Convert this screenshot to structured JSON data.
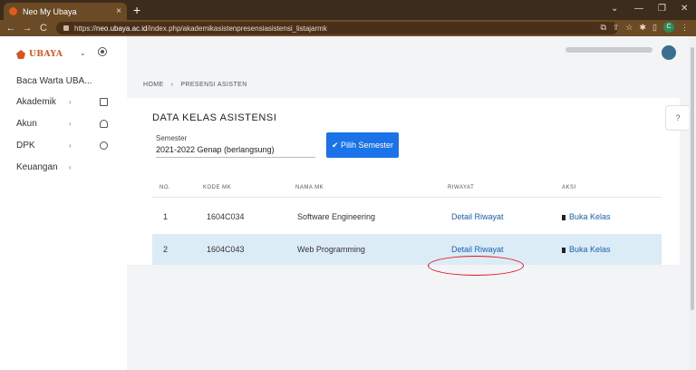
{
  "browser": {
    "tab_title": "Neo My Ubaya",
    "tab_close": "×",
    "new_tab": "+",
    "url_scheme": "https://",
    "url_host": "neo.ubaya.ac.id",
    "url_path": "/index.php/akademikasistenpresensiasistensi_listajarmk",
    "profile_initial": "C",
    "window_controls": [
      "⌄",
      "—",
      "❐",
      "✕"
    ],
    "nav": [
      "←",
      "→",
      "C"
    ],
    "toolbar_icons": [
      "⧉",
      "⇪",
      "☆",
      "✱",
      "▯",
      "⋮"
    ]
  },
  "sidebar": {
    "logo_text": "UBAYA",
    "items": [
      {
        "label": "Baca Warta UBA...",
        "arrow": "",
        "icon": ""
      },
      {
        "label": "Akademik",
        "arrow": "‹",
        "icon": "book-icon"
      },
      {
        "label": "Akun",
        "arrow": "‹",
        "icon": "user-icon"
      },
      {
        "label": "DPK",
        "arrow": "‹",
        "icon": "award-icon"
      },
      {
        "label": "Keuangan",
        "arrow": "‹",
        "icon": ""
      }
    ]
  },
  "breadcrumb": [
    "HOME",
    "›",
    "PRESENSI ASISTEN"
  ],
  "card": {
    "title": "DATA KELAS ASISTENSI",
    "semester_label": "Semester",
    "semester_value": "2021-2022 Genap (berlangsung)",
    "button_label": "✔ Pilih Semester",
    "columns": [
      "NO.",
      "KODE MK",
      "NAMA MK",
      "RIWAYAT",
      "AKSI"
    ],
    "rows": [
      {
        "no": "1",
        "kode": "1604C034",
        "nama": "Software Engineering",
        "riwayat": "Detail Riwayat",
        "aksi": "Buka Kelas"
      },
      {
        "no": "2",
        "kode": "1604C043",
        "nama": "Web Programming",
        "riwayat": "Detail Riwayat",
        "aksi": "Buka Kelas"
      }
    ]
  },
  "help_icon": "?"
}
